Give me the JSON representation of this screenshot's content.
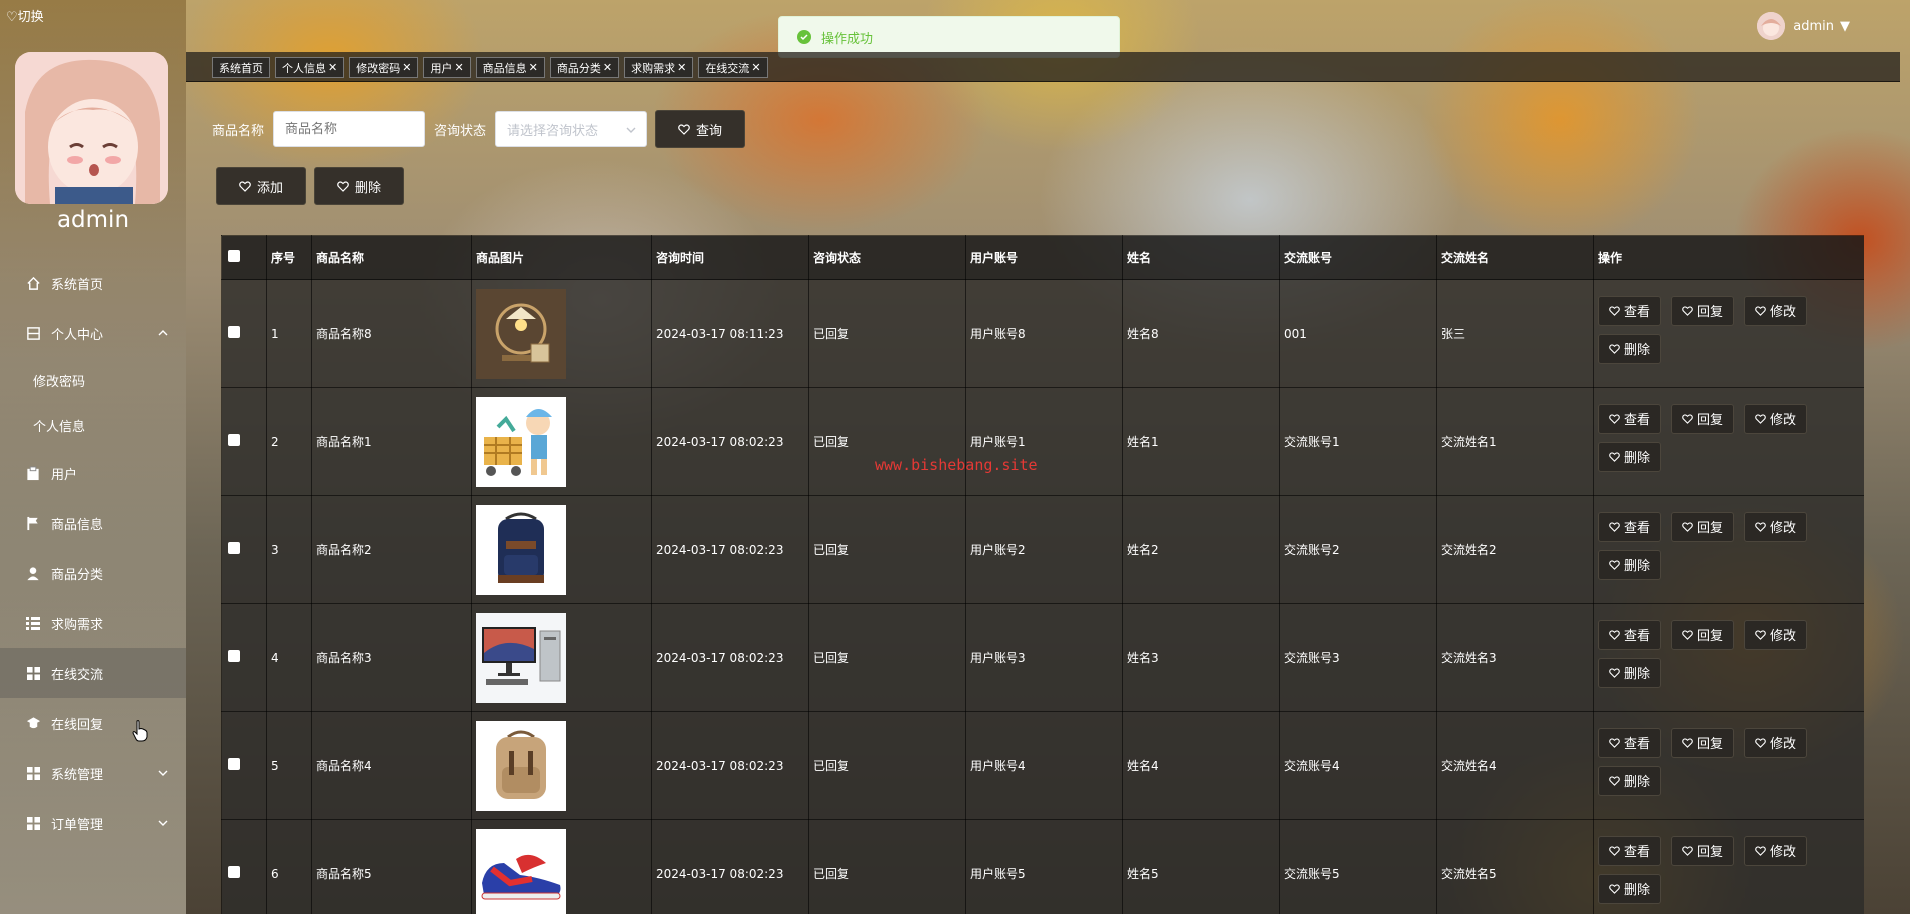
{
  "sidebar": {
    "switch_label": "♡切换",
    "admin_name": "admin",
    "menu": [
      {
        "label": "系统首页",
        "icon": "home-icon"
      },
      {
        "label": "个人中心",
        "icon": "person-card-icon"
      },
      {
        "label": "修改密码"
      },
      {
        "label": "个人信息"
      },
      {
        "label": "用户",
        "icon": "clipboard-icon"
      },
      {
        "label": "商品信息",
        "icon": "flag-icon"
      },
      {
        "label": "商品分类",
        "icon": "user-icon"
      },
      {
        "label": "求购需求",
        "icon": "list-icon"
      },
      {
        "label": "在线交流",
        "icon": "grid-icon"
      },
      {
        "label": "在线回复",
        "icon": "cap-icon"
      },
      {
        "label": "系统管理",
        "icon": "grid-icon"
      },
      {
        "label": "订单管理",
        "icon": "grid-icon"
      }
    ]
  },
  "header": {
    "user_label": "admin",
    "toast": "操作成功"
  },
  "tabs": [
    {
      "label": "系统首页",
      "closable": ""
    },
    {
      "label": "个人信息",
      "closable": "✕"
    },
    {
      "label": "修改密码",
      "closable": "✕"
    },
    {
      "label": "用户",
      "closable": "✕"
    },
    {
      "label": "商品信息",
      "closable": "✕"
    },
    {
      "label": "商品分类",
      "closable": "✕"
    },
    {
      "label": "求购需求",
      "closable": "✕"
    },
    {
      "label": "在线交流",
      "closable": "✕"
    }
  ],
  "search": {
    "name_label": "商品名称",
    "name_placeholder": "商品名称",
    "status_label": "咨询状态",
    "status_placeholder": "请选择咨询状态",
    "query_button": "查询"
  },
  "actions": {
    "add": "添加",
    "delete": "删除"
  },
  "table": {
    "headers": [
      "序号",
      "商品名称",
      "商品图片",
      "咨询时间",
      "咨询状态",
      "用户账号",
      "姓名",
      "交流账号",
      "交流姓名",
      "操作"
    ],
    "op_labels": [
      "查看",
      "回复",
      "修改",
      "删除"
    ],
    "rows": [
      {
        "no": "1",
        "name": "商品名称8",
        "image": "desk-lamp",
        "time": "2024-03-17 08:11:23",
        "status": "已回复",
        "account": "用户账号8",
        "username": "姓名8",
        "chat_account": "001",
        "chat_name": "张三"
      },
      {
        "no": "2",
        "name": "商品名称1",
        "image": "toy-cart",
        "time": "2024-03-17 08:02:23",
        "status": "已回复",
        "account": "用户账号1",
        "username": "姓名1",
        "chat_account": "交流账号1",
        "chat_name": "交流姓名1"
      },
      {
        "no": "3",
        "name": "商品名称2",
        "image": "backpack-blue",
        "time": "2024-03-17 08:02:23",
        "status": "已回复",
        "account": "用户账号2",
        "username": "姓名2",
        "chat_account": "交流账号2",
        "chat_name": "交流姓名2"
      },
      {
        "no": "4",
        "name": "商品名称3",
        "image": "desktop-computer",
        "time": "2024-03-17 08:02:23",
        "status": "已回复",
        "account": "用户账号3",
        "username": "姓名3",
        "chat_account": "交流账号3",
        "chat_name": "交流姓名3"
      },
      {
        "no": "5",
        "name": "商品名称4",
        "image": "backpack-tan",
        "time": "2024-03-17 08:02:23",
        "status": "已回复",
        "account": "用户账号4",
        "username": "姓名4",
        "chat_account": "交流账号4",
        "chat_name": "交流姓名4"
      },
      {
        "no": "6",
        "name": "商品名称5",
        "image": "sneaker",
        "time": "2024-03-17 08:02:23",
        "status": "已回复",
        "account": "用户账号5",
        "username": "姓名5",
        "chat_account": "交流账号5",
        "chat_name": "交流姓名5"
      }
    ]
  },
  "watermark": "www.bishebang.site",
  "colors": {
    "toast_success": "#67c23a",
    "watermark": "#e53935"
  }
}
